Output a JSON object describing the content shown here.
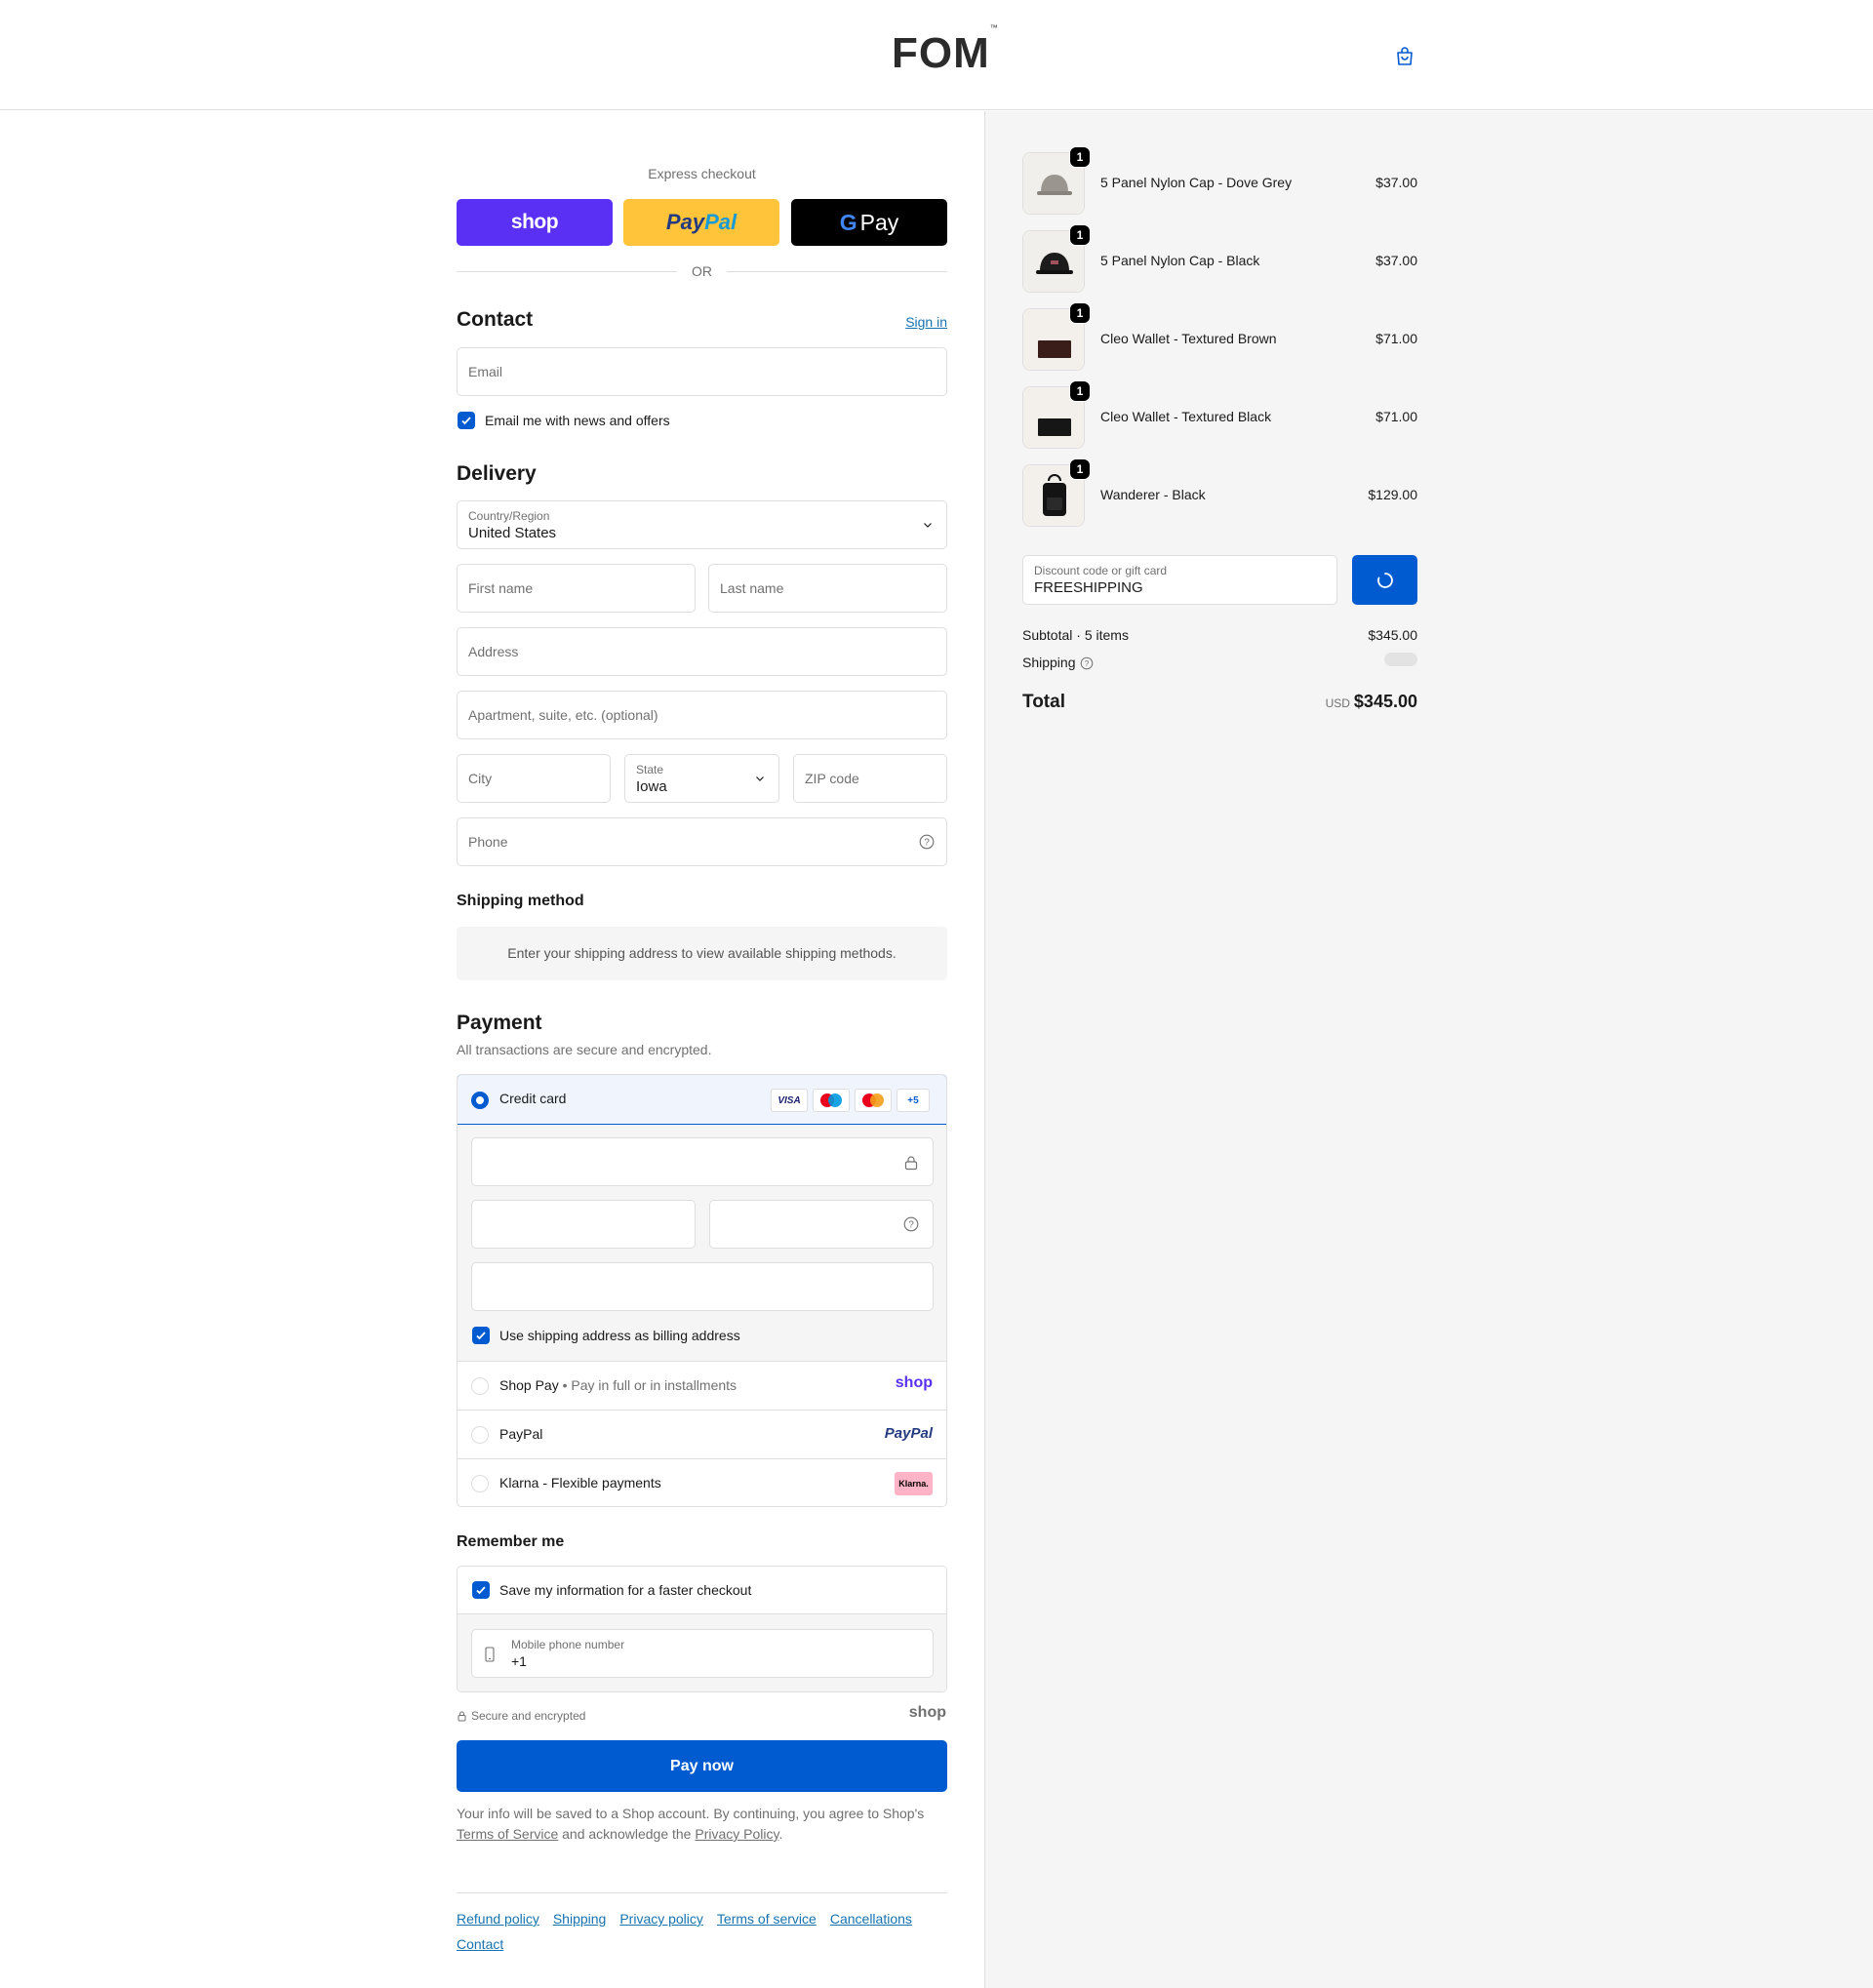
{
  "header": {
    "logo": "FOM",
    "logo_tm": "™"
  },
  "express": {
    "label": "Express checkout",
    "shop_label": "shop",
    "paypal_label_a": "Pay",
    "paypal_label_b": "Pal",
    "gpay_g": "G",
    "gpay_label": "Pay",
    "or": "OR"
  },
  "contact": {
    "title": "Contact",
    "sign_in": "Sign in",
    "email_placeholder": "Email",
    "news_label": "Email me with news and offers"
  },
  "delivery": {
    "title": "Delivery",
    "country_label": "Country/Region",
    "country_value": "United States",
    "first_name": "First name",
    "last_name": "Last name",
    "address": "Address",
    "apartment": "Apartment, suite, etc. (optional)",
    "city": "City",
    "state_label": "State",
    "state_value": "Iowa",
    "zip": "ZIP code",
    "phone": "Phone"
  },
  "shipping_method": {
    "title": "Shipping method",
    "message": "Enter your shipping address to view available shipping methods."
  },
  "payment": {
    "title": "Payment",
    "subtitle": "All transactions are secure and encrypted.",
    "credit_card": "Credit card",
    "card_visa": "VISA",
    "card_more": "+5",
    "billing_label": "Use shipping address as billing address",
    "shop_pay": "Shop Pay",
    "shop_pay_sub": "Pay in full or in installments",
    "shop_pay_logo": "shop",
    "paypal": "PayPal",
    "paypal_logo": "PayPal",
    "klarna": "Klarna - Flexible payments",
    "klarna_logo": "Klarna."
  },
  "remember": {
    "title": "Remember me",
    "save_label": "Save my information for a faster checkout",
    "mobile_label": "Mobile phone number",
    "mobile_value": "+1",
    "secure": "Secure and encrypted",
    "shop_logo": "shop"
  },
  "pay_now": "Pay now",
  "legal": {
    "text_a": "Your info will be saved to a Shop account. By continuing, you agree to Shop's",
    "terms": "Terms of Service",
    "text_b": "and acknowledge the",
    "privacy": "Privacy Policy",
    "text_c": "."
  },
  "footer": {
    "links": [
      "Refund policy",
      "Shipping",
      "Privacy policy",
      "Terms of service",
      "Cancellations",
      "Contact"
    ]
  },
  "order": {
    "items": [
      {
        "name": "5 Panel Nylon Cap - Dove Grey",
        "price": "$37.00",
        "qty": "1"
      },
      {
        "name": "5 Panel Nylon Cap - Black",
        "price": "$37.00",
        "qty": "1"
      },
      {
        "name": "Cleo Wallet - Textured Brown",
        "price": "$71.00",
        "qty": "1"
      },
      {
        "name": "Cleo Wallet - Textured Black",
        "price": "$71.00",
        "qty": "1"
      },
      {
        "name": "Wanderer - Black",
        "price": "$129.00",
        "qty": "1"
      }
    ],
    "discount_label": "Discount code or gift card",
    "discount_value": "FREESHIPPING",
    "subtotal_label": "Subtotal · 5 items",
    "subtotal_value": "$345.00",
    "shipping_label": "Shipping",
    "total_label": "Total",
    "currency": "USD",
    "total_value": "$345.00"
  },
  "colors": {
    "accent": "#005bd1",
    "link": "#1773b0",
    "shop_purple": "#5a31f4",
    "paypal_yellow": "#ffc439"
  }
}
